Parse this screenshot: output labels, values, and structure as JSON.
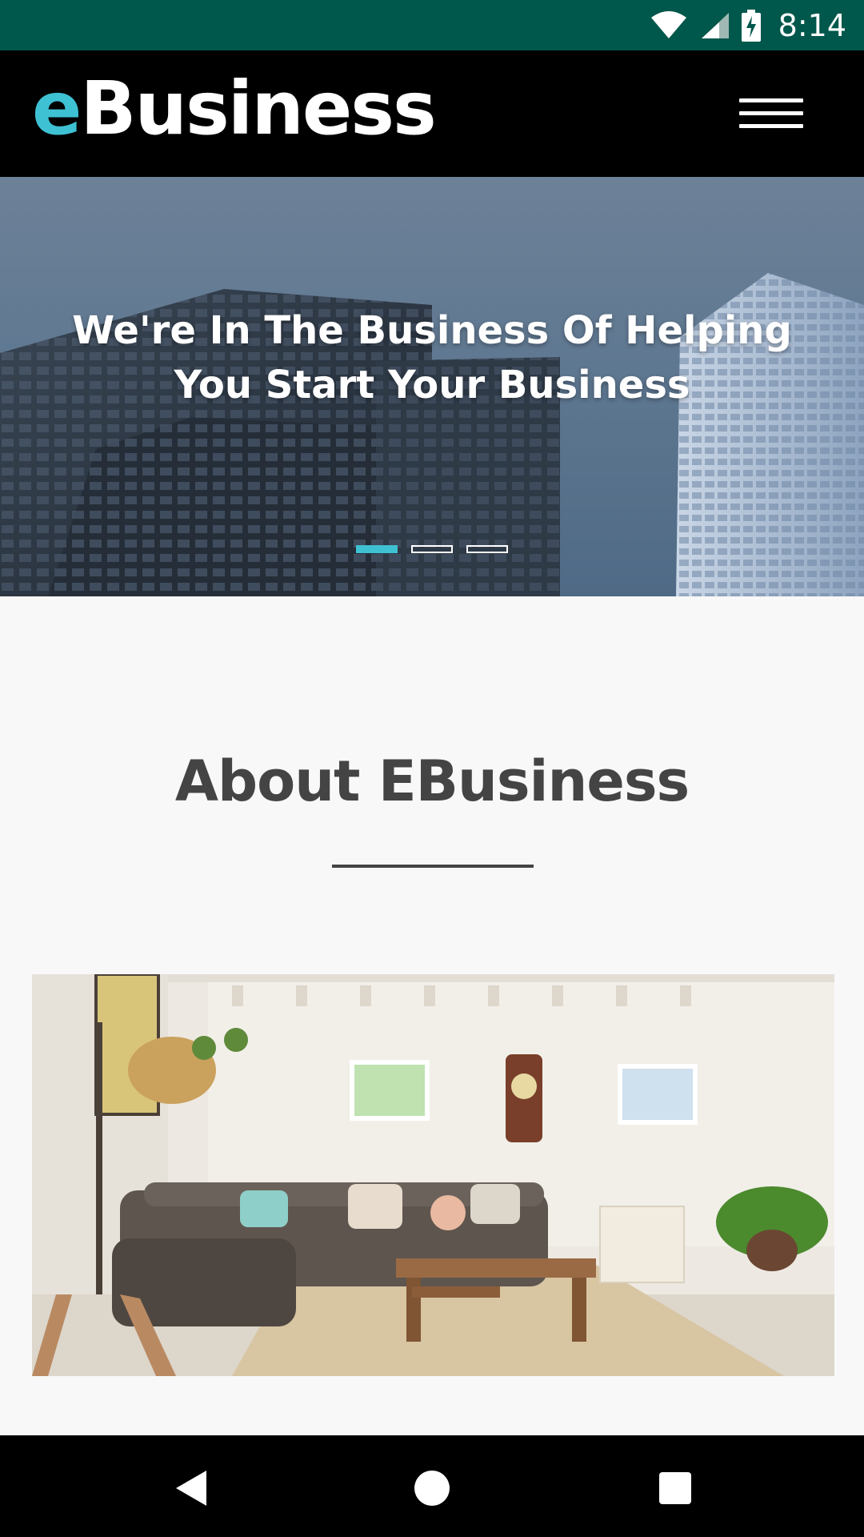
{
  "status_bar": {
    "time": "8:14",
    "icons": [
      "wifi-icon",
      "cell-signal-icon",
      "battery-charging-icon"
    ],
    "background": "#00574b"
  },
  "header": {
    "brand_accent": "e",
    "brand_rest": "Business",
    "menu_icon": "hamburger-menu-icon",
    "background": "#000000",
    "accent_color": "#3ec1d3"
  },
  "hero": {
    "title": "We're In The Business Of Helping You Start Your Business",
    "slides": 3,
    "active_slide": 1
  },
  "about": {
    "title": "About EBusiness",
    "image_alt": "living-room-photo"
  },
  "nav_bar": {
    "buttons": [
      "back-icon",
      "home-icon",
      "recents-icon"
    ]
  }
}
